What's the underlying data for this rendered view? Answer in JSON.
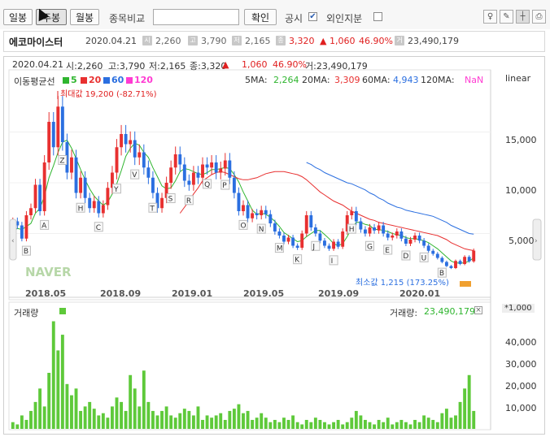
{
  "toolbar": {
    "tabs": [
      "일봉",
      "주봉",
      "월봉"
    ],
    "compare_label": "종목비교",
    "confirm_label": "확인",
    "disclosure_label": "공시",
    "foreign_label": "외인지분"
  },
  "stock": {
    "name": "에코마이스터",
    "date": "2020.04.21",
    "open": "2,260",
    "high": "3,790",
    "low": "2,165",
    "close": "3,320",
    "change": "▲ 1,060",
    "change_pct": "46.90%",
    "volume": "23,490,179"
  },
  "chart_header": {
    "date": "2020.04.21",
    "open": "시:2,260",
    "high": "고:3,790",
    "low": "저:2,165",
    "close": "종:3,320",
    "arrow": "▲",
    "change": "1,060",
    "change_pct": "46.90%",
    "volume": "거:23,490,179"
  },
  "ma_legend": {
    "label": "이동평균선",
    "items": [
      {
        "label": "5",
        "color": "#2fb52f"
      },
      {
        "label": "20",
        "color": "#e83030"
      },
      {
        "label": "60",
        "color": "#2b6fe0"
      },
      {
        "label": "120",
        "color": "#ff3bd2"
      }
    ]
  },
  "ma_values": {
    "ma5_label": "5MA:",
    "ma5": "2,264",
    "ma20_label": "20MA:",
    "ma20": "3,309",
    "ma60_label": "60MA:",
    "ma60": "4,943",
    "ma120_label": "120MA:",
    "ma120": "NaN"
  },
  "scale_mode": "linear",
  "max_label": "최대값 19,200 (-82.71%)",
  "min_label": "최소값 1,215 (173.25%)",
  "watermark": "NAVER",
  "price_axis": [
    "15,000",
    "10,000",
    "5,000"
  ],
  "time_axis": [
    "2018.05",
    "2018.09",
    "2019.01",
    "2019.05",
    "2019.09",
    "2020.01"
  ],
  "volume_panel": {
    "label": "거래량",
    "value_label": "거래량:",
    "value": "23,490,179",
    "unit": "*1,000",
    "axis": [
      "40,000",
      "30,000",
      "20,000",
      "10,000"
    ]
  },
  "disclosure_marks": [
    "B",
    "A",
    "Z",
    "H",
    "C",
    "Y",
    "V",
    "T",
    "S",
    "R",
    "Q",
    "P",
    "O",
    "N",
    "M",
    "K",
    "J",
    "I",
    "H",
    "G",
    "E",
    "D",
    "U"
  ],
  "chart_data": {
    "type": "candlestick",
    "y_range": [
      0,
      20000
    ],
    "candles": [
      {
        "o": 5200,
        "c": 6200
      },
      {
        "o": 6200,
        "c": 5800
      },
      {
        "o": 5800,
        "c": 4500
      },
      {
        "o": 4500,
        "c": 6800
      },
      {
        "o": 6800,
        "c": 7500
      },
      {
        "o": 7500,
        "c": 9800
      },
      {
        "o": 9800,
        "c": 7200
      },
      {
        "o": 7200,
        "c": 12000
      },
      {
        "o": 12000,
        "c": 16000
      },
      {
        "o": 16000,
        "c": 13500
      },
      {
        "o": 13500,
        "c": 17500
      },
      {
        "o": 17500,
        "c": 14000
      },
      {
        "o": 14000,
        "c": 11000
      },
      {
        "o": 11000,
        "c": 12500
      },
      {
        "o": 12500,
        "c": 9000
      },
      {
        "o": 9000,
        "c": 10500
      },
      {
        "o": 10500,
        "c": 8500
      },
      {
        "o": 8500,
        "c": 7500
      },
      {
        "o": 7500,
        "c": 8200
      },
      {
        "o": 8200,
        "c": 7000
      },
      {
        "o": 7000,
        "c": 7800
      },
      {
        "o": 7800,
        "c": 9500
      },
      {
        "o": 9500,
        "c": 11000
      },
      {
        "o": 11000,
        "c": 13500
      },
      {
        "o": 13500,
        "c": 14800
      },
      {
        "o": 14800,
        "c": 13800
      },
      {
        "o": 13800,
        "c": 14200
      },
      {
        "o": 14200,
        "c": 12500
      },
      {
        "o": 12500,
        "c": 13000
      },
      {
        "o": 13000,
        "c": 11500
      },
      {
        "o": 11500,
        "c": 10500
      },
      {
        "o": 10500,
        "c": 9000
      },
      {
        "o": 9000,
        "c": 7500
      },
      {
        "o": 7500,
        "c": 8500
      },
      {
        "o": 8500,
        "c": 10000
      },
      {
        "o": 10000,
        "c": 11500
      },
      {
        "o": 11500,
        "c": 12800
      },
      {
        "o": 12800,
        "c": 11800
      },
      {
        "o": 11800,
        "c": 10200
      },
      {
        "o": 10200,
        "c": 9800
      },
      {
        "o": 9800,
        "c": 11000
      },
      {
        "o": 11000,
        "c": 10500
      },
      {
        "o": 10500,
        "c": 11800
      },
      {
        "o": 11800,
        "c": 11500
      },
      {
        "o": 11500,
        "c": 12000
      },
      {
        "o": 12000,
        "c": 11000
      },
      {
        "o": 11000,
        "c": 11400
      },
      {
        "o": 11400,
        "c": 12200
      },
      {
        "o": 12200,
        "c": 10500
      },
      {
        "o": 10500,
        "c": 9000
      },
      {
        "o": 9000,
        "c": 7200
      },
      {
        "o": 7200,
        "c": 7800
      },
      {
        "o": 7800,
        "c": 6500
      },
      {
        "o": 6500,
        "c": 7000
      },
      {
        "o": 7000,
        "c": 6800
      },
      {
        "o": 6800,
        "c": 7300
      },
      {
        "o": 7300,
        "c": 6900
      },
      {
        "o": 6900,
        "c": 6000
      },
      {
        "o": 6000,
        "c": 5200
      },
      {
        "o": 5200,
        "c": 4800
      },
      {
        "o": 4800,
        "c": 4200
      },
      {
        "o": 4200,
        "c": 4600
      },
      {
        "o": 4600,
        "c": 3800
      },
      {
        "o": 3800,
        "c": 3600
      },
      {
        "o": 3600,
        "c": 5000
      },
      {
        "o": 5000,
        "c": 6800
      },
      {
        "o": 6800,
        "c": 5600
      },
      {
        "o": 5600,
        "c": 5000
      },
      {
        "o": 5000,
        "c": 4300
      },
      {
        "o": 4300,
        "c": 3800
      },
      {
        "o": 3800,
        "c": 3500
      },
      {
        "o": 3500,
        "c": 4200
      },
      {
        "o": 4200,
        "c": 3700
      },
      {
        "o": 3700,
        "c": 5200
      },
      {
        "o": 5200,
        "c": 6800
      },
      {
        "o": 6800,
        "c": 7200
      },
      {
        "o": 7200,
        "c": 6200
      },
      {
        "o": 6200,
        "c": 5400
      },
      {
        "o": 5400,
        "c": 5000
      },
      {
        "o": 5000,
        "c": 5600
      },
      {
        "o": 5600,
        "c": 5300
      },
      {
        "o": 5300,
        "c": 5800
      },
      {
        "o": 5800,
        "c": 5000
      },
      {
        "o": 5000,
        "c": 4600
      },
      {
        "o": 4600,
        "c": 4800
      },
      {
        "o": 4800,
        "c": 5200
      },
      {
        "o": 5200,
        "c": 4500
      },
      {
        "o": 4500,
        "c": 4000
      },
      {
        "o": 4000,
        "c": 4400
      },
      {
        "o": 4400,
        "c": 4800
      },
      {
        "o": 4800,
        "c": 4300
      },
      {
        "o": 4300,
        "c": 3800
      },
      {
        "o": 3800,
        "c": 3300
      },
      {
        "o": 3300,
        "c": 3000
      },
      {
        "o": 3000,
        "c": 2600
      },
      {
        "o": 2600,
        "c": 2200
      },
      {
        "o": 2200,
        "c": 1800
      },
      {
        "o": 1800,
        "c": 1600
      },
      {
        "o": 1600,
        "c": 2300
      },
      {
        "o": 2300,
        "c": 2000
      },
      {
        "o": 2000,
        "c": 2700
      },
      {
        "o": 2700,
        "c": 2260
      },
      {
        "o": 2260,
        "c": 3320
      }
    ],
    "ma5": [
      5200,
      5500,
      5400,
      5700,
      6000,
      7000,
      7500,
      8700,
      10500,
      11700,
      13000,
      14000,
      14200,
      13400,
      12400,
      11300,
      10300,
      9400,
      8700,
      8200,
      7800,
      8100,
      8900,
      9900,
      11200,
      12600,
      13400,
      13900,
      13700,
      13000,
      12500,
      11500,
      10600,
      9700,
      9400,
      9500,
      10200,
      11100,
      11400,
      11300,
      11100,
      10900,
      10800,
      11000,
      11300,
      11300,
      11400,
      11500,
      11400,
      10800,
      10100,
      9100,
      8200,
      7300,
      6900,
      7000,
      6900,
      6600,
      6200,
      5700,
      5100,
      4800,
      4500,
      4200,
      4300,
      4700,
      5000,
      5300,
      5300,
      4900,
      4500,
      4000,
      3800,
      4000,
      4700,
      5500,
      6100,
      6100,
      5900,
      5800,
      5400,
      5400,
      5300,
      5200,
      5000,
      4900,
      4800,
      4600,
      4500,
      4500,
      4400,
      4300,
      4100,
      3800,
      3500,
      3100,
      2700,
      2300,
      2100,
      2100,
      2100,
      2300,
      2600
    ],
    "ma20": [
      7000,
      7600,
      8200,
      8900,
      9500,
      10200,
      10500,
      10800,
      11000,
      11100,
      11000,
      10800,
      10600,
      10400,
      10300,
      10300,
      10400,
      10500,
      10700,
      10900,
      11000,
      11100,
      11100,
      11100,
      11000,
      10900,
      10800,
      10600,
      10300,
      9900,
      9500,
      9100,
      8800,
      8500,
      8200,
      8000,
      7800,
      7500,
      7200,
      7000,
      6800,
      6600,
      6400,
      6300,
      6100,
      6000,
      5900,
      5800,
      5700,
      5600,
      5500,
      5400,
      5300,
      5200,
      5100,
      5000,
      4900,
      4800,
      4600,
      4400,
      4100,
      3900,
      3700,
      3500,
      3400,
      3320
    ],
    "ma60": [
      12000,
      11800,
      11500,
      11300,
      11000,
      10800,
      10600,
      10400,
      10200,
      10000,
      9900,
      9700,
      9500,
      9300,
      9000,
      8800,
      8500,
      8300,
      8000,
      7800,
      7600,
      7500,
      7300,
      7200,
      7100,
      7000,
      6900,
      6800,
      6700,
      6500,
      6300,
      6100,
      5800,
      5600,
      5400,
      5200,
      5000,
      4943
    ]
  },
  "volume_data": [
    3,
    2,
    6,
    4,
    8,
    12,
    18,
    10,
    25,
    48,
    35,
    42,
    20,
    15,
    18,
    8,
    10,
    12,
    9,
    6,
    7,
    5,
    10,
    14,
    12,
    8,
    24,
    18,
    10,
    26,
    12,
    8,
    6,
    8,
    10,
    6,
    5,
    7,
    9,
    8,
    6,
    10,
    4,
    6,
    5,
    6,
    7,
    4,
    8,
    9,
    11,
    7,
    8,
    4,
    5,
    7,
    5,
    3,
    4,
    3,
    5,
    4,
    6,
    3,
    2,
    4,
    3,
    5,
    4,
    3,
    2,
    3,
    4,
    2,
    3,
    5,
    8,
    6,
    4,
    3,
    2,
    4,
    3,
    5,
    2,
    3,
    4,
    3,
    2,
    4,
    3,
    6,
    5,
    4,
    3,
    7,
    9,
    5,
    6,
    12,
    18,
    24,
    8
  ],
  "volume_ylim": [
    0,
    50
  ]
}
